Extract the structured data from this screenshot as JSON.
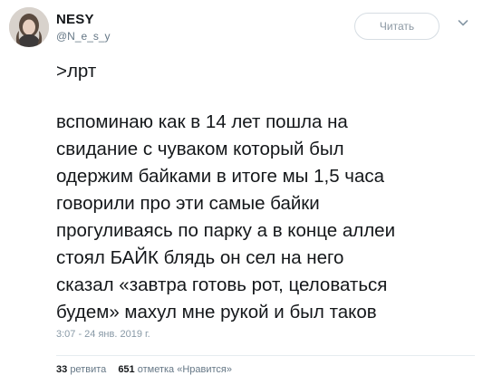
{
  "tweet": {
    "author_name": "NESY",
    "author_handle": "@N_e_s_y",
    "follow_label": "Читать",
    "text_lines_1": [
      ">лрт"
    ],
    "text_lines_2": [
      "вспоминаю как в 14 лет пошла на",
      "свидание с чуваком который был",
      "одержим байками в итоге мы 1,5 часа",
      "говорили про эти самые байки",
      "прогуливаясь по парку а в конце аллеи",
      "стоял БАЙК блядь он сел на него",
      "сказал «завтра готовь рот, целоваться",
      "будем» махул мне рукой и был таков"
    ],
    "timestamp": "3:07 - 24 янв. 2019 г.",
    "retweets_count": "33",
    "retweets_label": "ретвита",
    "likes_count": "651",
    "likes_label": "отметка «Нравится»"
  },
  "icons": {
    "avatar": "avatar",
    "caret": "chevron-down-icon"
  },
  "colors": {
    "text": "#14171a",
    "secondary": "#657786",
    "button_border": "#d6dde3"
  }
}
